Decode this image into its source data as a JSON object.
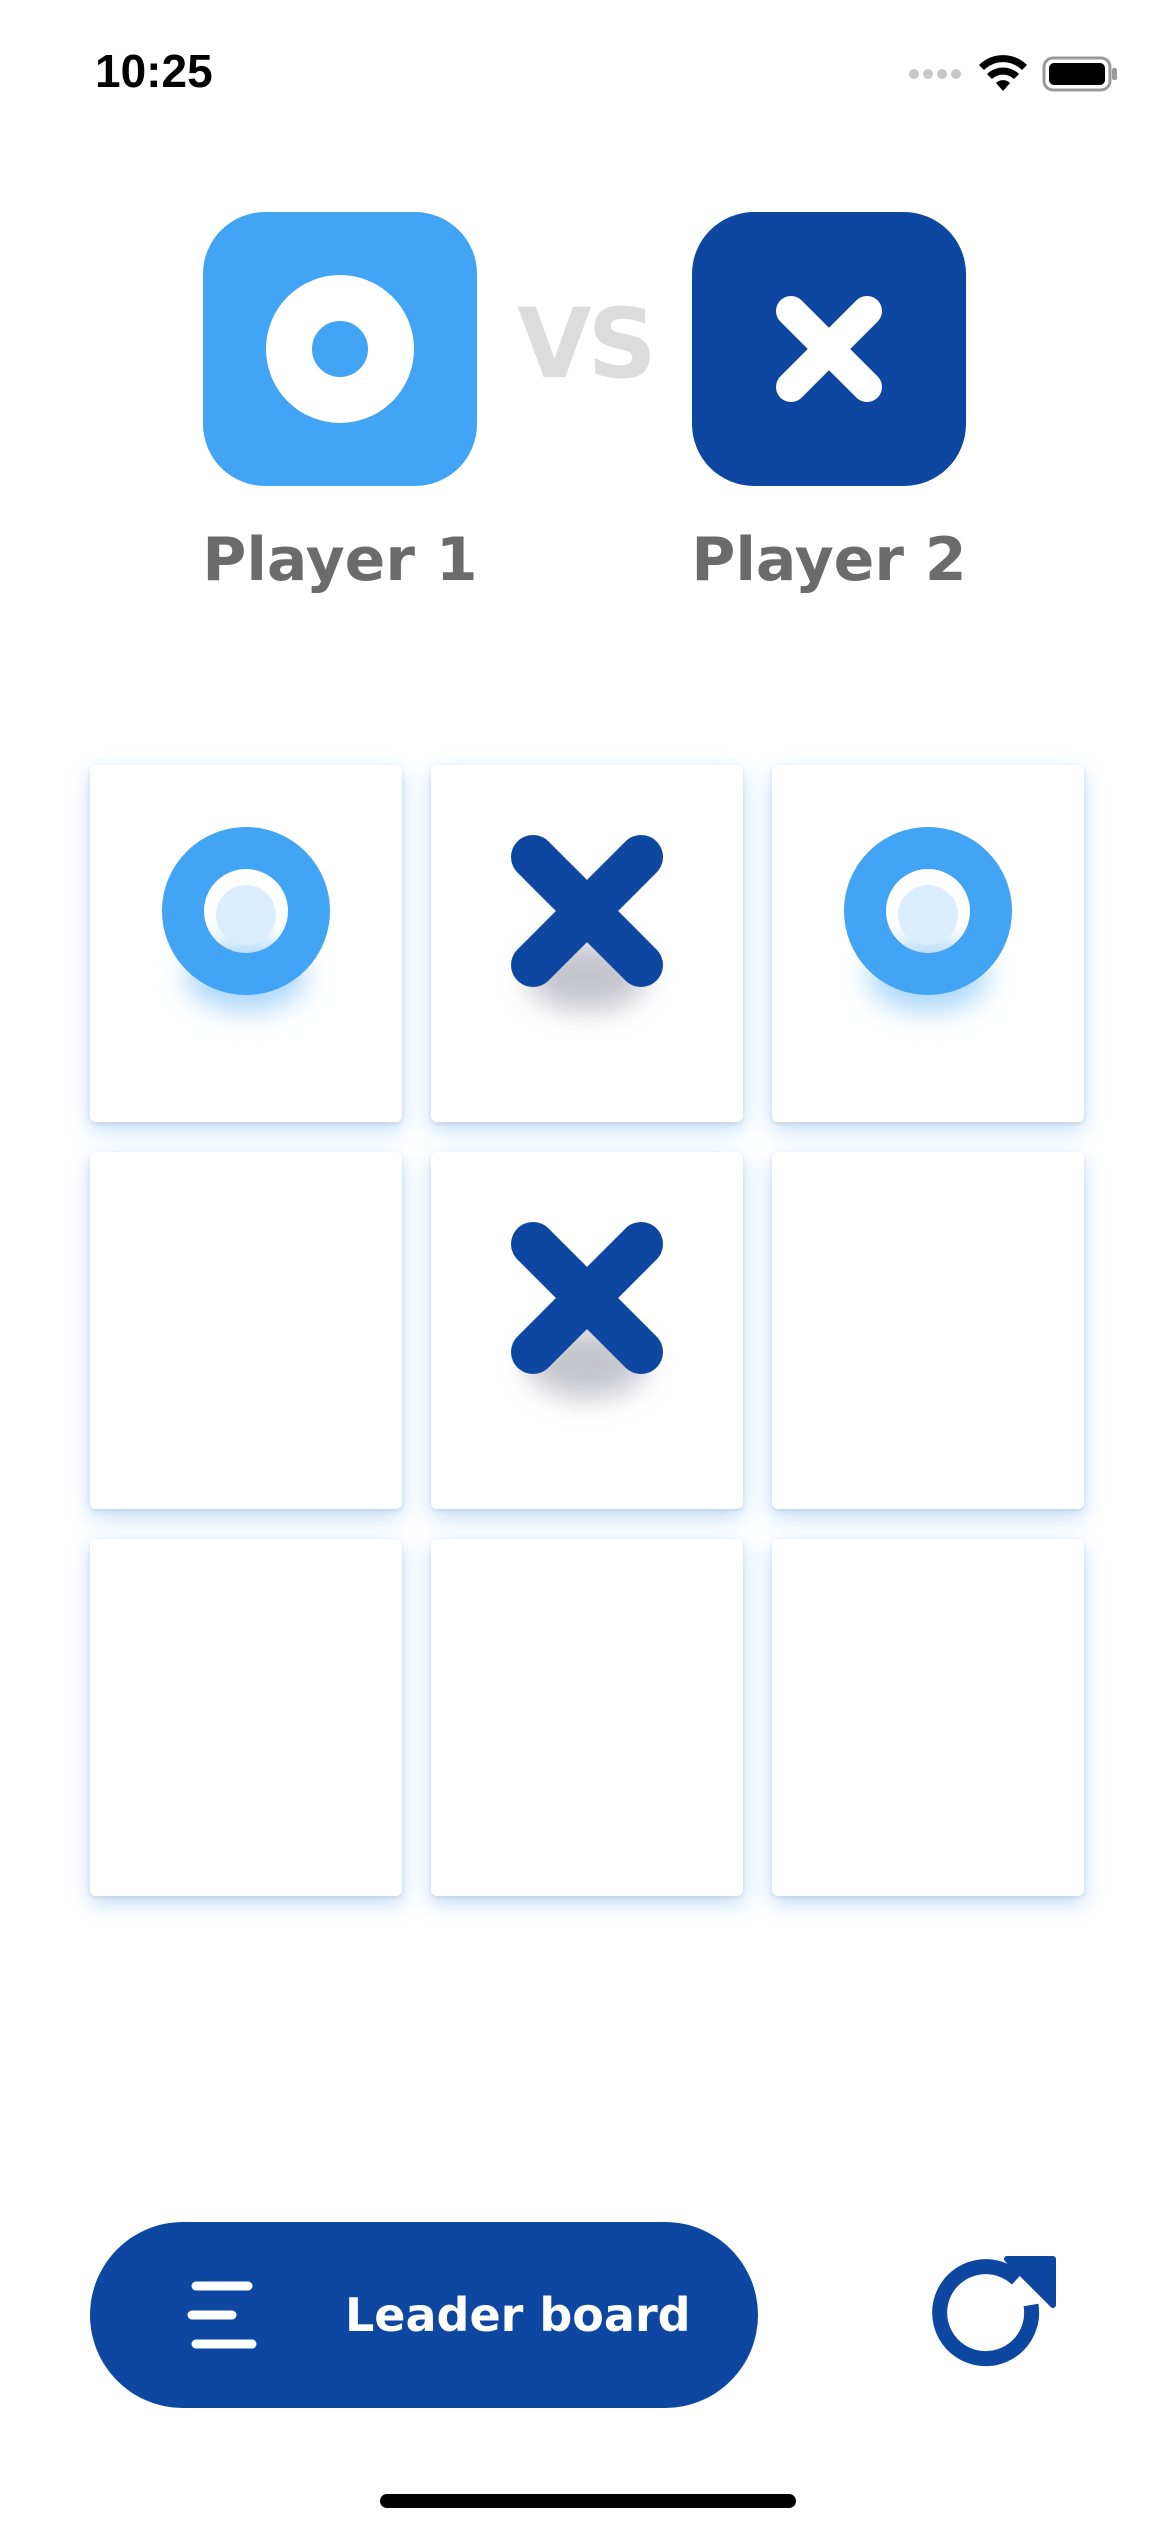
{
  "status_bar": {
    "time": "10:25",
    "signal_icon": "cellular-signal-icon",
    "wifi_icon": "wifi-icon",
    "battery_icon": "battery-icon"
  },
  "players": [
    {
      "label": "Player 1",
      "symbol": "O",
      "icon": "o-symbol-icon",
      "tile_color": "#42a4f5"
    },
    {
      "label": "Player 2",
      "symbol": "X",
      "icon": "x-symbol-icon",
      "tile_color": "#0e47a1"
    }
  ],
  "vs_label": "VS",
  "board": {
    "cells": [
      "O",
      "X",
      "O",
      "",
      "X",
      "",
      "",
      "",
      ""
    ],
    "o_color": "#42a4f5",
    "x_color": "#0e47a1"
  },
  "bottom_bar": {
    "leader_board_label": "Leader board",
    "leader_board_icon": "menu-lines-icon",
    "restart_icon": "restart-icon",
    "accent_color": "#0e47a1"
  }
}
